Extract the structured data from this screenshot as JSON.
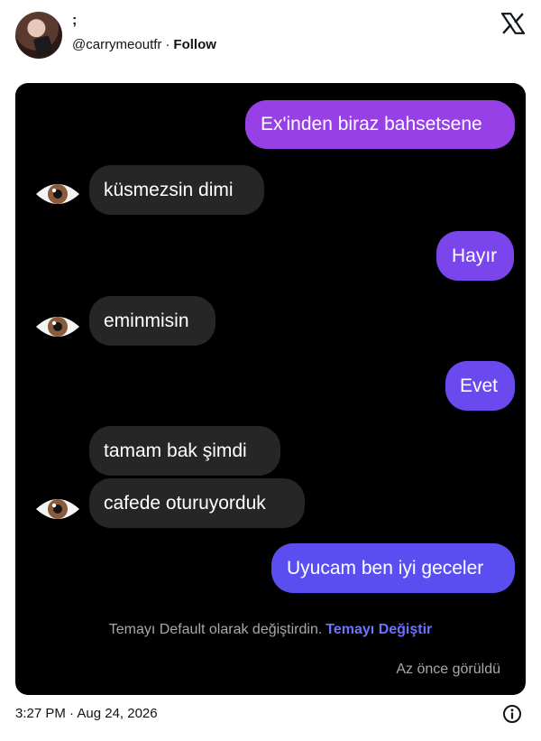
{
  "tweet": {
    "display_name": ";",
    "handle": "@carrymeoutfr",
    "separator": "·",
    "follow_label": "Follow",
    "timestamp": "3:27 PM · Aug 24, 2026"
  },
  "chat": {
    "messages": [
      {
        "side": "sent",
        "text": "Ex'inden biraz bahsetsene"
      },
      {
        "side": "received",
        "text": "küsmezsin dimi"
      },
      {
        "side": "sent",
        "text": "Hayır"
      },
      {
        "side": "received",
        "text": "eminmisin"
      },
      {
        "side": "sent",
        "text": "Evet"
      },
      {
        "side": "received",
        "text": "tamam bak şimdi"
      },
      {
        "side": "received",
        "text": "cafede oturuyorduk"
      },
      {
        "side": "sent",
        "text": "Uyucam ben iyi geceler"
      }
    ],
    "system_notice": "Temayı Default olarak değiştirdin.",
    "system_link": "Temayı Değiştir",
    "seen_status": "Az önce görüldü"
  },
  "colors": {
    "sent_top": "#9b3fe6",
    "sent_bottom": "#5b4ef0",
    "received": "#262626",
    "link": "#6f72ff"
  },
  "icons": [
    "x-logo-icon",
    "eye-avatar-icon",
    "info-icon"
  ]
}
